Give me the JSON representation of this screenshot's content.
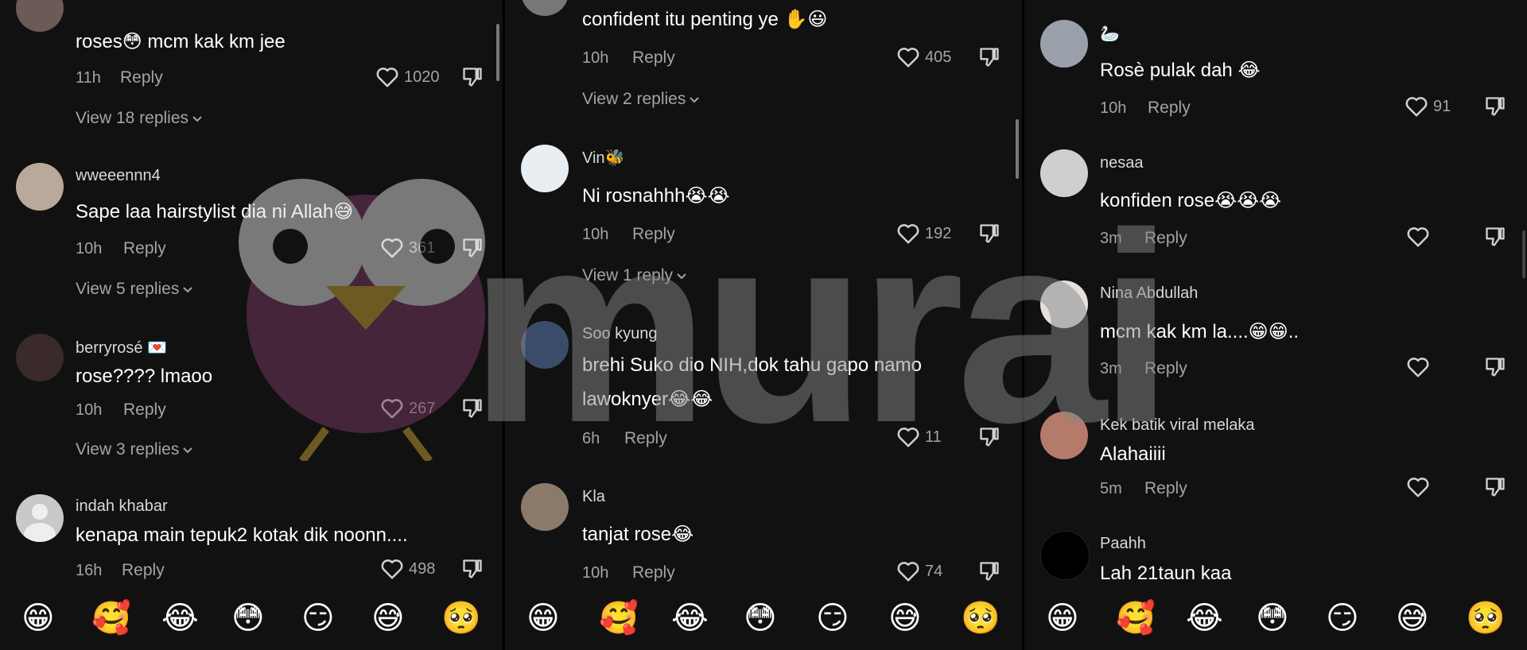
{
  "emojis": [
    "😁",
    "🥰",
    "😂",
    "😳",
    "😏",
    "😅",
    "🥺"
  ],
  "watermark": {
    "text": "murai"
  },
  "columns": [
    {
      "view_top": "View 18 replies",
      "comments": [
        {
          "text": "roses😳 mcm kak km jee",
          "time": "11h",
          "reply": "Reply",
          "likes": "1020"
        },
        {
          "user": "wweeennn4",
          "text": "Sape laa hairstylist dia ni Allah😅",
          "time": "10h",
          "reply": "Reply",
          "likes": "361",
          "view": "View 5 replies"
        },
        {
          "user": "berryrosé 💌",
          "text": "rose???? lmaoo",
          "time": "10h",
          "reply": "Reply",
          "likes": "267",
          "view": "View 3 replies"
        },
        {
          "user": "indah khabar",
          "text": "kenapa main tepuk2 kotak dik noonn....",
          "time": "16h",
          "reply": "Reply",
          "likes": "498"
        }
      ]
    },
    {
      "comments": [
        {
          "text": "confident itu penting ye ✋😃",
          "time": "10h",
          "reply": "Reply",
          "likes": "405",
          "view": "View 2 replies"
        },
        {
          "user": "Vin🐝",
          "text": "Ni rosnahhh😭😭",
          "time": "10h",
          "reply": "Reply",
          "likes": "192",
          "view": "View 1 reply"
        },
        {
          "user": "Soo kyung",
          "text": "brehi Suko dio NIH,dok tahu gapo namo",
          "text2": "lawoknyer😂😂",
          "time": "6h",
          "reply": "Reply",
          "likes": "11"
        },
        {
          "user": "Kla",
          "text": "tanjat rose😂",
          "time": "10h",
          "reply": "Reply",
          "likes": "74"
        }
      ]
    },
    {
      "comments": [
        {
          "user": "🦢",
          "text": "Rosè pulak dah 😂",
          "time": "10h",
          "reply": "Reply",
          "likes": "91"
        },
        {
          "user": "nesaa",
          "text": "konfiden rose😭😭😭",
          "time": "3m",
          "reply": "Reply"
        },
        {
          "user": "Nina Abdullah",
          "text": "mcm kak km la....😁😁..",
          "time": "3m",
          "reply": "Reply"
        },
        {
          "user": "Kek batik viral melaka",
          "text": "Alahaiiii",
          "time": "5m",
          "reply": "Reply"
        },
        {
          "user": "Paahh",
          "text": "Lah 21taun kaa"
        }
      ]
    }
  ]
}
